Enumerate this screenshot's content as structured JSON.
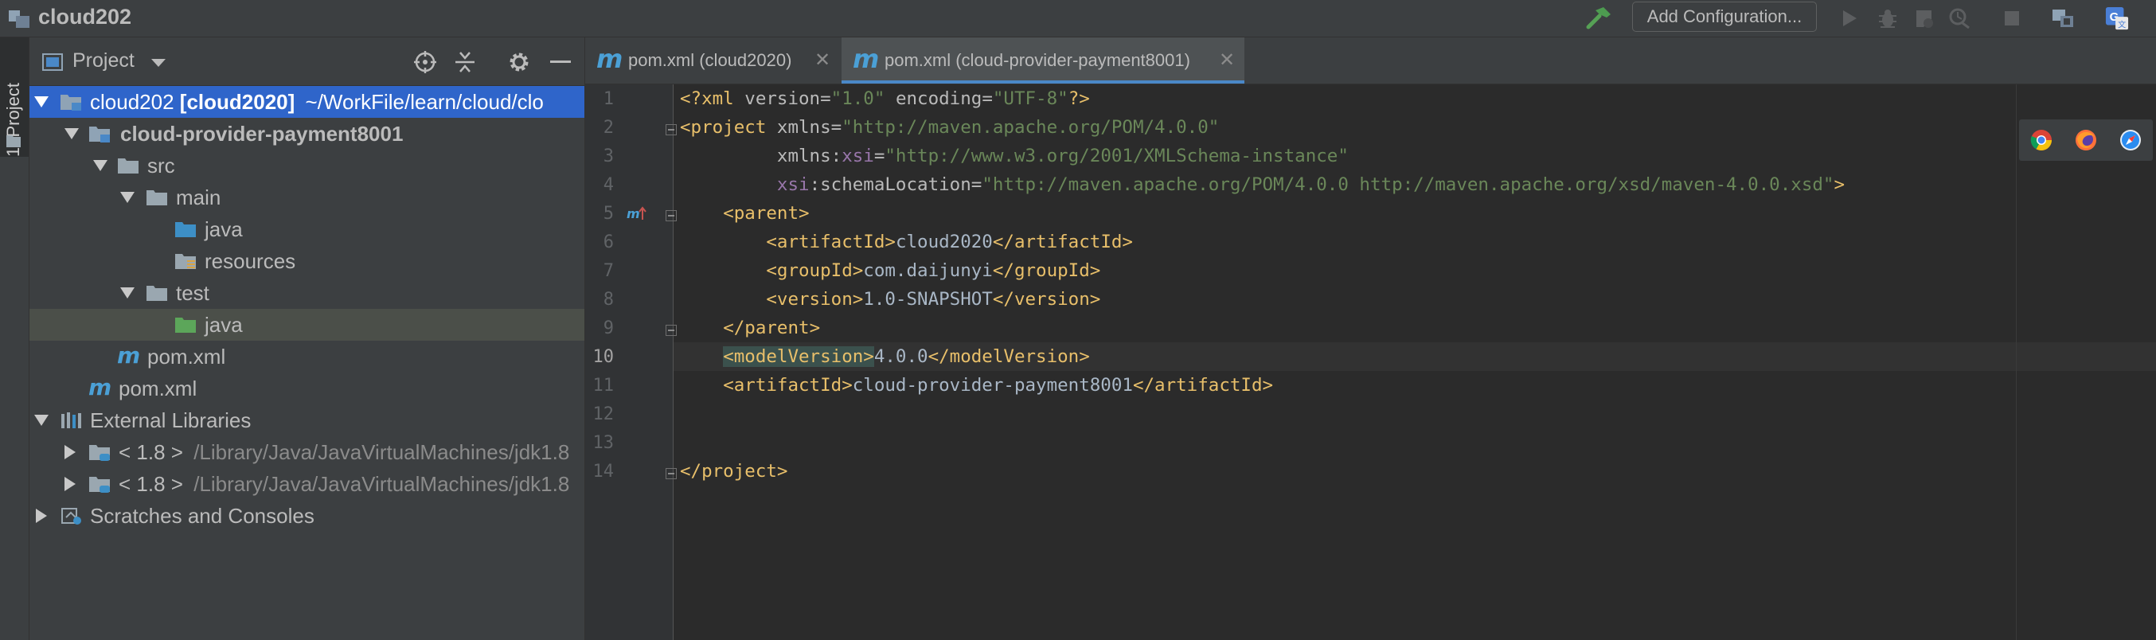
{
  "window": {
    "title": "cloud202"
  },
  "toolbar": {
    "add_config_label": "Add Configuration...",
    "icons": [
      "build-hammer-icon",
      "run-icon",
      "debug-icon",
      "coverage-icon",
      "profile-icon",
      "stop-icon",
      "project-structure-icon",
      "translate-icon"
    ]
  },
  "left_strip": {
    "tab_label": "1: Project"
  },
  "project_panel": {
    "title": "Project",
    "tree": [
      {
        "label": "cloud202",
        "label_bold": "[cloud2020]",
        "path": "~/WorkFile/learn/cloud/clo",
        "icon": "module-folder",
        "expanded": true,
        "selected": true
      },
      {
        "label": "cloud-provider-payment8001",
        "icon": "module-folder",
        "expanded": true
      },
      {
        "label": "src",
        "icon": "folder",
        "expanded": true
      },
      {
        "label": "main",
        "icon": "folder",
        "expanded": true
      },
      {
        "label": "java",
        "icon": "source-folder"
      },
      {
        "label": "resources",
        "icon": "resources-folder"
      },
      {
        "label": "test",
        "icon": "folder",
        "expanded": true
      },
      {
        "label": "java",
        "icon": "test-folder",
        "hover": true
      },
      {
        "label": "pom.xml",
        "icon": "maven-file"
      },
      {
        "label": "pom.xml",
        "icon": "maven-file"
      },
      {
        "label": "External Libraries",
        "icon": "libraries",
        "expanded": true
      },
      {
        "label": "< 1.8 >",
        "path": "/Library/Java/JavaVirtualMachines/jdk1.8",
        "icon": "jdk",
        "expanded": false
      },
      {
        "label": "< 1.8 >",
        "path": "/Library/Java/JavaVirtualMachines/jdk1.8",
        "icon": "jdk",
        "expanded": false
      },
      {
        "label": "Scratches and Consoles",
        "icon": "scratches",
        "expanded": false
      }
    ]
  },
  "editor": {
    "tabs": [
      {
        "label": "pom.xml (cloud2020)",
        "active": false
      },
      {
        "label": "pom.xml (cloud-provider-payment8001)",
        "active": true
      }
    ],
    "current_line": 10,
    "line_numbers": [
      "1",
      "2",
      "3",
      "4",
      "5",
      "6",
      "7",
      "8",
      "9",
      "10",
      "11",
      "12",
      "13",
      "14"
    ],
    "lines": [
      "<?xml version=\"1.0\" encoding=\"UTF-8\"?>",
      "<project xmlns=\"http://maven.apache.org/POM/4.0.0\"",
      "         xmlns:xsi=\"http://www.w3.org/2001/XMLSchema-instance\"",
      "         xsi:schemaLocation=\"http://maven.apache.org/POM/4.0.0 http://maven.apache.org/xsd/maven-4.0.0.xsd\">",
      "    <parent>",
      "        <artifactId>cloud2020</artifactId>",
      "        <groupId>com.daijunyi</groupId>",
      "        <version>1.0-SNAPSHOT</version>",
      "    </parent>",
      "    <modelVersion>4.0.0</modelVersion>",
      "    <artifactId>cloud-provider-payment8001</artifactId>",
      "",
      "",
      "</project>"
    ],
    "browsers": [
      "chrome-icon",
      "firefox-icon",
      "safari-icon"
    ]
  }
}
